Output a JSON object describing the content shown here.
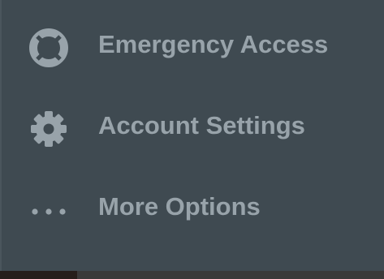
{
  "menu": {
    "items": [
      {
        "label": "Emergency Access",
        "icon": "lifebuoy-icon"
      },
      {
        "label": "Account Settings",
        "icon": "gear-icon"
      },
      {
        "label": "More Options",
        "icon": "ellipsis-icon"
      }
    ]
  },
  "colors": {
    "background": "#3f4a51",
    "text": "#98a3aa",
    "icon": "#98a3aa"
  }
}
